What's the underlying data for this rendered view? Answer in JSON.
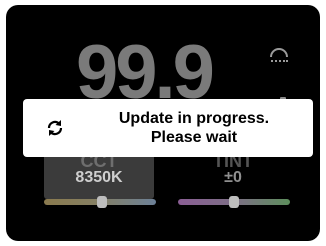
{
  "display": {
    "value": "99.9"
  },
  "cct": {
    "label": "CCT",
    "value": "8350K",
    "slider_position": 0.52
  },
  "tint": {
    "label": "TINT",
    "value": "±0",
    "slider_position": 0.5
  },
  "dialog": {
    "line1": "Update in progress.",
    "line2": "Please wait",
    "icon": "sync-icon"
  },
  "colors": {
    "background": "#000000",
    "dialog": "#ffffff",
    "cct_panel": "#3b3b3b"
  }
}
